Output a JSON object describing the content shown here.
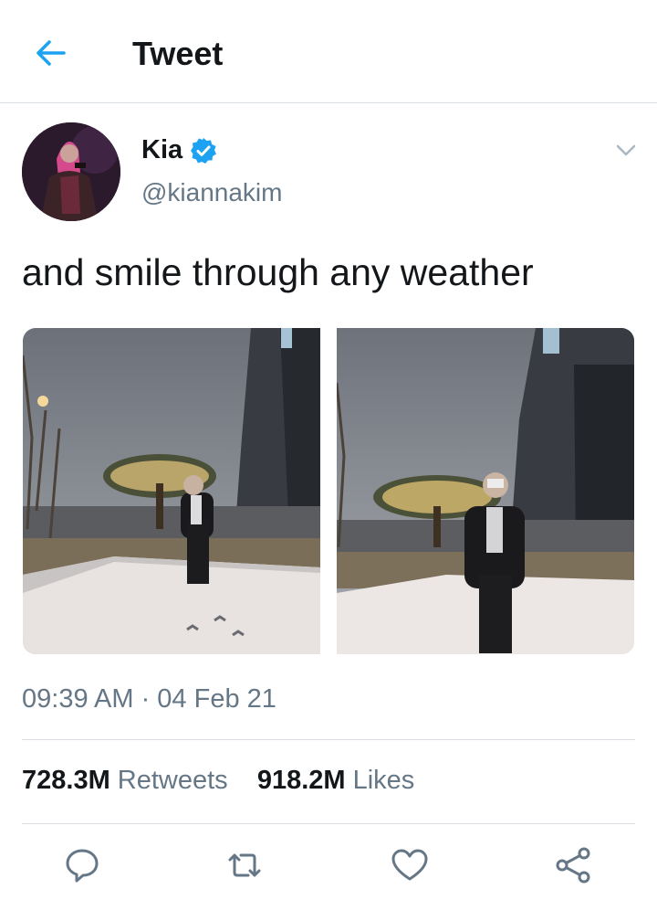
{
  "header": {
    "title": "Tweet",
    "back_icon": "arrow-left-icon"
  },
  "author": {
    "name": "Kia",
    "handle": "@kiannakim",
    "verified": true
  },
  "tweet": {
    "text": "and smile through any weather",
    "photos": [
      "photo",
      "photo"
    ],
    "timestamp": "09:39 AM · 04 Feb 21"
  },
  "stats": {
    "retweets_count": "728.3M",
    "retweets_label": "Retweets",
    "likes_count": "918.2M",
    "likes_label": "Likes"
  },
  "actions": [
    "reply-icon",
    "retweet-icon",
    "like-icon",
    "share-icon"
  ],
  "colors": {
    "accent": "#1da1f2",
    "text": "#14171a",
    "secondary": "#657786",
    "divider": "#d8dee3"
  }
}
